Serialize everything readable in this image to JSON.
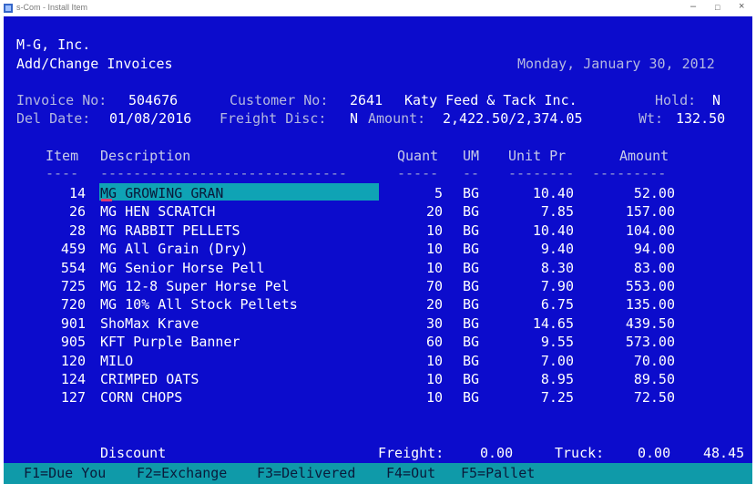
{
  "window": {
    "title": "s-Com - Install Item"
  },
  "header": {
    "company": "M-G, Inc.",
    "screen_title": "Add/Change Invoices",
    "date": "Monday, January 30, 2012"
  },
  "invoice": {
    "invoice_no_label": "Invoice No:",
    "invoice_no": "504676",
    "customer_no_label": "Customer No:",
    "customer_no": "2641",
    "customer_name": "Katy Feed & Tack Inc.",
    "hold_label": "Hold:",
    "hold": "N",
    "del_date_label": "Del Date:",
    "del_date": "01/08/2016",
    "freight_disc_label": "Freight Disc:",
    "freight_disc": "N",
    "amount_label": "Amount:",
    "amount": "2,422.50/2,374.05",
    "wt_label": "Wt:",
    "wt": "132.50"
  },
  "table": {
    "columns": {
      "item": "Item",
      "description": "Description",
      "quant": "Quant",
      "um": "UM",
      "unit_pr": "Unit Pr",
      "amount": "Amount"
    },
    "dashes": {
      "item": "----",
      "description": "------------------------------",
      "quant": "-----",
      "um": "--",
      "unit_pr": "--------",
      "amount": "---------"
    },
    "rows": [
      {
        "item": "14",
        "description": "MG GROWING GRAN",
        "quant": "5",
        "um": "BG",
        "unit_pr": "10.40",
        "amount": "52.00"
      },
      {
        "item": "26",
        "description": "MG HEN SCRATCH",
        "quant": "20",
        "um": "BG",
        "unit_pr": "7.85",
        "amount": "157.00"
      },
      {
        "item": "28",
        "description": "MG RABBIT PELLETS",
        "quant": "10",
        "um": "BG",
        "unit_pr": "10.40",
        "amount": "104.00"
      },
      {
        "item": "459",
        "description": "MG All Grain (Dry)",
        "quant": "10",
        "um": "BG",
        "unit_pr": "9.40",
        "amount": "94.00"
      },
      {
        "item": "554",
        "description": "MG Senior Horse Pell",
        "quant": "10",
        "um": "BG",
        "unit_pr": "8.30",
        "amount": "83.00"
      },
      {
        "item": "725",
        "description": "MG 12-8 Super Horse Pel",
        "quant": "70",
        "um": "BG",
        "unit_pr": "7.90",
        "amount": "553.00"
      },
      {
        "item": "720",
        "description": "MG 10% All Stock Pellets",
        "quant": "20",
        "um": "BG",
        "unit_pr": "6.75",
        "amount": "135.00"
      },
      {
        "item": "901",
        "description": "ShoMax Krave",
        "quant": "30",
        "um": "BG",
        "unit_pr": "14.65",
        "amount": "439.50"
      },
      {
        "item": "905",
        "description": "KFT Purple Banner",
        "quant": "60",
        "um": "BG",
        "unit_pr": "9.55",
        "amount": "573.00"
      },
      {
        "item": "120",
        "description": "MILO",
        "quant": "10",
        "um": "BG",
        "unit_pr": "7.00",
        "amount": "70.00"
      },
      {
        "item": "124",
        "description": "CRIMPED OATS",
        "quant": "10",
        "um": "BG",
        "unit_pr": "8.95",
        "amount": "89.50"
      },
      {
        "item": "127",
        "description": "CORN CHOPS",
        "quant": "10",
        "um": "BG",
        "unit_pr": "7.25",
        "amount": "72.50"
      }
    ]
  },
  "footer": {
    "discount_label": "Discount",
    "freight_label": "Freight:",
    "freight": "0.00",
    "truck_label": "Truck:",
    "truck": "0.00",
    "right_value": "48.45"
  },
  "function_keys": [
    {
      "label": "F1=Due You"
    },
    {
      "label": "F2=Exchange"
    },
    {
      "label": "F3=Delivered"
    },
    {
      "label": "F4=Out"
    },
    {
      "label": "F5=Pallet"
    }
  ],
  "colors": {
    "screen_bg": "#0c0ccc",
    "highlight": "#0fa3b5",
    "function_bar": "#0f9aa9",
    "cursor": "#e03c6e"
  }
}
